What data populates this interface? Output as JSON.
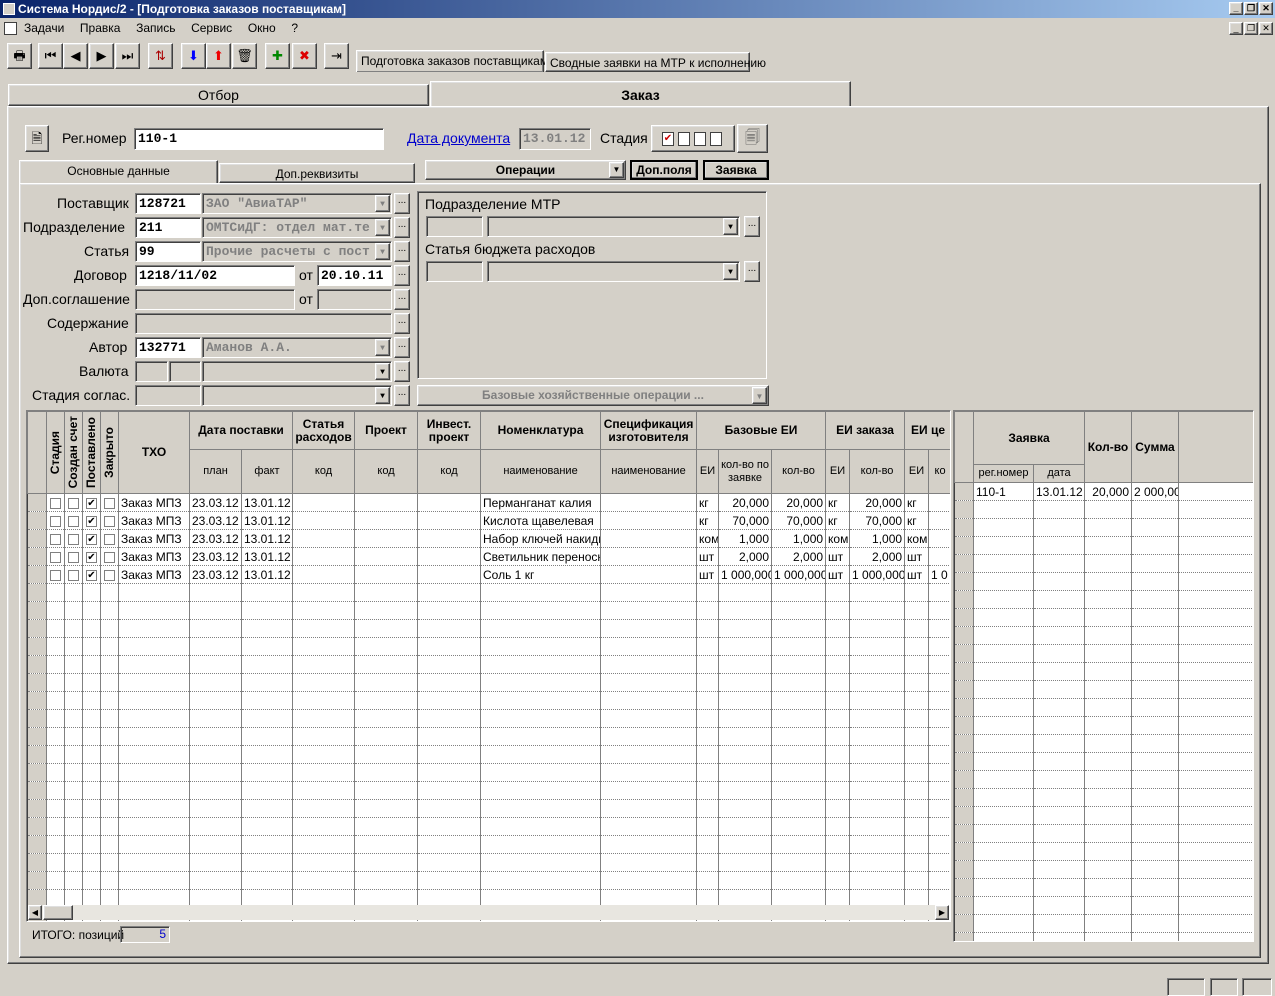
{
  "window": {
    "title": "Система Нордис/2 - [Подготовка заказов поставщикам]"
  },
  "menu": [
    "Задачи",
    "Правка",
    "Запись",
    "Сервис",
    "Окно",
    "?"
  ],
  "top_tabs": [
    "Подготовка заказов поставщикам",
    "Сводные заявки на МТР к исполнению"
  ],
  "main_tabs": [
    "Отбор",
    "Заказ"
  ],
  "header": {
    "reg_label": "Рег.номер",
    "reg_value": "110-1",
    "doc_date_label": "Дата документа",
    "doc_date_value": "13.01.12",
    "stage_label": "Стадия"
  },
  "subtabs": [
    "Основные данные",
    "Доп.реквизиты"
  ],
  "ops": {
    "operations": "Операции",
    "extra_fields": "Доп.поля",
    "request": "Заявка"
  },
  "form": {
    "supplier": {
      "label": "Поставщик",
      "code": "128721",
      "name": "ЗАО \"АвиаТАР\""
    },
    "division": {
      "label": "Подразделение",
      "code": "211",
      "name": "ОМТСиДГ: отдел мат.те"
    },
    "article": {
      "label": "Статья",
      "code": "99",
      "name": "Прочие расчеты с пост"
    },
    "contract": {
      "label": "Договор",
      "value": "1218/11/02",
      "from_label": "от",
      "date": "20.10.11"
    },
    "addendum": {
      "label": "Доп.соглашение",
      "from_label": "от"
    },
    "content": {
      "label": "Содержание"
    },
    "author": {
      "label": "Автор",
      "code": "132771",
      "name": "Аманов А.А."
    },
    "currency": {
      "label": "Валюта"
    },
    "approval": {
      "label": "Стадия соглас."
    }
  },
  "mtr": {
    "division_label": "Подразделение МТР",
    "budget_label": "Статья бюджета расходов",
    "base_ops": "Базовые хозяйственные операции ..."
  },
  "grid": {
    "h": {
      "stage": "Стадия",
      "invoice": "Создан счет",
      "delivered": "Поставлено",
      "closed": "Закрыто",
      "txo": "ТХО",
      "delivery_date": "Дата поставки",
      "plan": "план",
      "fact": "факт",
      "cost_article": "Статья расходов",
      "project": "Проект",
      "invest": "Инвест. проект",
      "code": "код",
      "nomenclature": "Номенклатура",
      "spec": "Спецификация изготовителя",
      "name": "наименование",
      "base_unit": "Базовые ЕИ",
      "order_unit": "ЕИ заказа",
      "price_unit": "ЕИ це",
      "ei": "ЕИ",
      "qty_req": "кол-во по заявке",
      "qty": "кол-во",
      "ko": "ко"
    },
    "rows": [
      {
        "txo": "Заказ МПЗ",
        "plan": "23.03.12",
        "fact": "13.01.12",
        "nom": "Перманганат калия",
        "ei": "кг",
        "qr": "20,000",
        "q": "20,000",
        "oei": "кг",
        "oq": "20,000",
        "pei": "кг",
        "pq": ""
      },
      {
        "txo": "Заказ МПЗ",
        "plan": "23.03.12",
        "fact": "13.01.12",
        "nom": "Кислота щавелевая",
        "ei": "кг",
        "qr": "70,000",
        "q": "70,000",
        "oei": "кг",
        "oq": "70,000",
        "pei": "кг",
        "pq": ""
      },
      {
        "txo": "Заказ МПЗ",
        "plan": "23.03.12",
        "fact": "13.01.12",
        "nom": "Набор ключей накидны",
        "ei": "ком",
        "qr": "1,000",
        "q": "1,000",
        "oei": "ком",
        "oq": "1,000",
        "pei": "ком",
        "pq": ""
      },
      {
        "txo": "Заказ МПЗ",
        "plan": "23.03.12",
        "fact": "13.01.12",
        "nom": "Светильник переносно",
        "ei": "шт",
        "qr": "2,000",
        "q": "2,000",
        "oei": "шт",
        "oq": "2,000",
        "pei": "шт",
        "pq": ""
      },
      {
        "txo": "Заказ МПЗ",
        "plan": "23.03.12",
        "fact": "13.01.12",
        "nom": "Соль 1 кг",
        "ei": "шт",
        "qr": "1 000,000",
        "q": "1 000,000",
        "oei": "шт",
        "oq": "1 000,000",
        "pei": "шт",
        "pq": "1 0"
      }
    ],
    "total_label": "ИТОГО: позиций",
    "total_value": "5"
  },
  "right_grid": {
    "h": {
      "request": "Заявка",
      "reg": "рег.номер",
      "date": "дата",
      "qty": "Кол-во",
      "sum": "Сумма"
    },
    "rows": [
      {
        "reg": "110-1",
        "date": "13.01.12",
        "qty": "20,000",
        "sum": "2 000,00"
      }
    ]
  }
}
